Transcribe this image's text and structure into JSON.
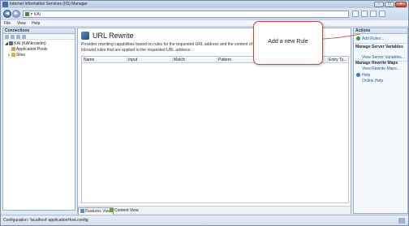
{
  "window": {
    "title": "Internet Information Services (IIS) Manager",
    "controls": {
      "minimize": "–",
      "maximize": "□",
      "close": "✕"
    }
  },
  "address": {
    "segments": [
      "KAI"
    ],
    "separator": "▸"
  },
  "menu": {
    "items": [
      "File",
      "View",
      "Help"
    ]
  },
  "connections": {
    "header": "Connections",
    "tree": [
      {
        "label": "KAI (KAI\\knstelm)",
        "level": 0,
        "icon": "server-icon"
      },
      {
        "label": "Application Pools",
        "level": 1,
        "icon": "app-pools-icon"
      },
      {
        "label": "Sites",
        "level": 1,
        "icon": "sites-icon"
      }
    ]
  },
  "main": {
    "title": "URL Rewrite",
    "description": "Provides rewriting capabilities based on rules for the requested URL address and the content of an HTTP",
    "note": "Inbound rules that are applied to the requested URL address:",
    "columns": [
      "Name",
      "Input",
      "Match",
      "Pattern",
      "Entry Ty..."
    ],
    "rows": [],
    "view_tabs": [
      "Features View",
      "Content View"
    ],
    "active_view": "Features View"
  },
  "actions": {
    "header": "Actions",
    "items": [
      {
        "type": "link",
        "label": "Add Rules...",
        "icon": "add-icon"
      },
      {
        "type": "group",
        "label": "Manage Server Variables"
      },
      {
        "type": "link",
        "label": "View Server Variables...",
        "icon": ""
      },
      {
        "type": "group",
        "label": "Manage Rewrite Maps"
      },
      {
        "type": "link",
        "label": "View Rewrite Maps...",
        "icon": ""
      },
      {
        "type": "link",
        "label": "Help",
        "icon": "help-icon"
      },
      {
        "type": "link",
        "label": "Online Help",
        "icon": ""
      }
    ]
  },
  "callout": {
    "text": "Add a new Rule",
    "border_color": "#c9463a"
  },
  "status": {
    "text": "Configuration: 'localhost' applicationHost.config"
  },
  "colors": {
    "accent": "#1e5aa8",
    "chrome": "#dfe7f1",
    "pane_border": "#9db0c8"
  }
}
